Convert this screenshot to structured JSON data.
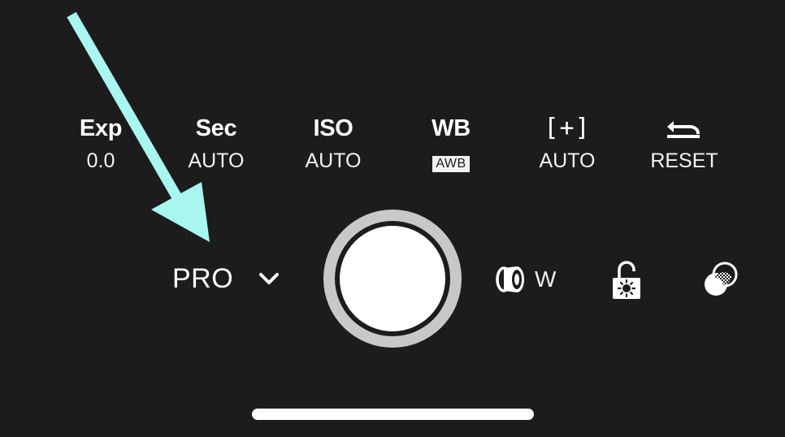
{
  "controls": [
    {
      "title": "Exp",
      "value": "0.0"
    },
    {
      "title": "Sec",
      "value": "AUTO"
    },
    {
      "title": "ISO",
      "value": "AUTO"
    },
    {
      "title": "WB",
      "value": "AWB"
    },
    {
      "title": "[+]",
      "value": "AUTO"
    },
    {
      "title_icon": "reset-undo-icon",
      "value": "RESET"
    }
  ],
  "mode": {
    "label": "PRO",
    "icon": "chevron-down-icon"
  },
  "shutter": {
    "icon": "shutter-button"
  },
  "lens": {
    "label": "W",
    "icon": "lens-icon"
  },
  "exposure_lock": {
    "icon": "unlocked-exposure-lock-icon"
  },
  "filter": {
    "icon": "filter-overlay-icon"
  },
  "annotation": {
    "arrow_color": "#a9f5f0"
  },
  "colors": {
    "background": "#1c1c1c",
    "text": "#ffffff",
    "shutter_ring": "#c8c8c8",
    "shutter_fill": "#ffffff"
  }
}
